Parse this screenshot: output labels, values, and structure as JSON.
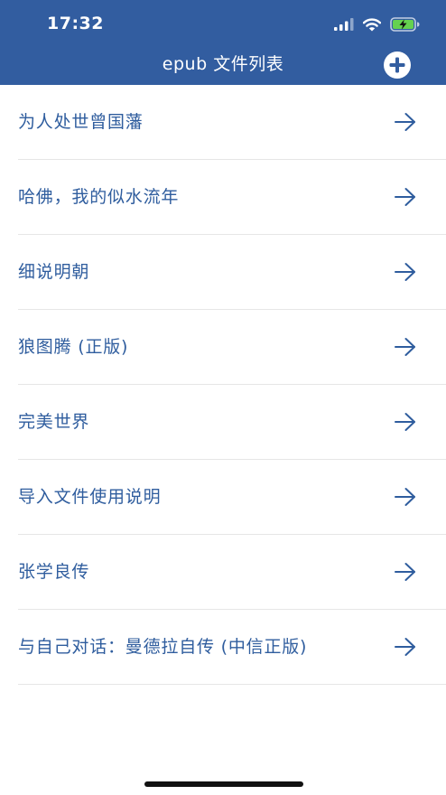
{
  "status_bar": {
    "time": "17:32"
  },
  "header": {
    "title": "epub 文件列表",
    "add_icon": "plus-circle-icon"
  },
  "files": [
    {
      "title": "为人处世曾国藩"
    },
    {
      "title": "哈佛，我的似水流年"
    },
    {
      "title": "细说明朝"
    },
    {
      "title": "狼图腾 (正版)"
    },
    {
      "title": "完美世界"
    },
    {
      "title": "导入文件使用说明"
    },
    {
      "title": "张学良传"
    },
    {
      "title": "与自己对话：曼德拉自传 (中信正版)"
    }
  ],
  "colors": {
    "header_background": "#325da0",
    "item_text": "#2f5d9e",
    "battery_fill": "#65d14f"
  }
}
